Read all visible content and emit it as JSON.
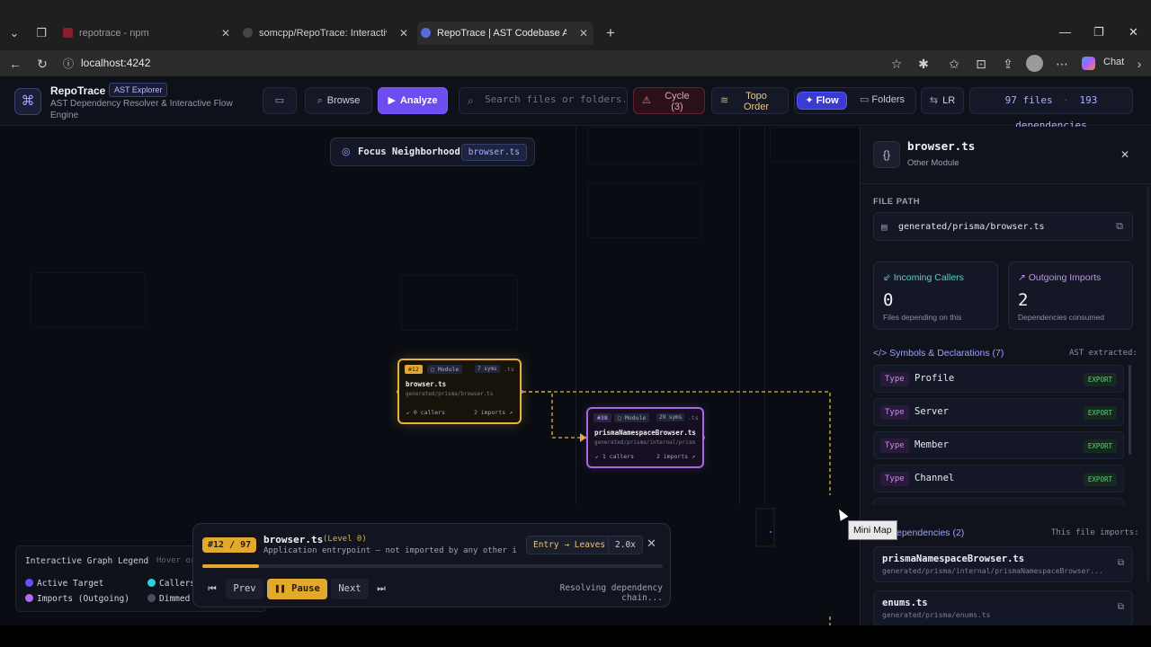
{
  "browser": {
    "tabs": [
      {
        "label": "repotrace - npm",
        "active": false
      },
      {
        "label": "somcpp/RepoTrace: Interactive co",
        "active": false
      },
      {
        "label": "RepoTrace | AST Codebase Archite",
        "active": true
      }
    ],
    "url": "localhost:4242",
    "chat_label": "Chat"
  },
  "header": {
    "brand": "RepoTrace",
    "brand_tag": "AST Explorer",
    "subtitle": "AST Dependency Resolver & Interactive Flow Engine",
    "browse_label": "Browse",
    "analyze_label": "Analyze",
    "search_placeholder": "Search files or folders...",
    "cycle_line1": "Cycle",
    "cycle_line2": "(3)",
    "topo_line1": "Topo",
    "topo_line2": "Order",
    "flow_label": "Flow",
    "folders_label": "Folders",
    "direction_label": "LR",
    "files_count": "97 files",
    "deps_count": "193 dependencies"
  },
  "canvas": {
    "focus_label": "Focus Neighborhood",
    "focus_file": "browser.ts",
    "node_a": {
      "badge": "#12",
      "kind": "Module",
      "syms": "7 syms",
      "ext": ".ts",
      "title": "browser.ts",
      "path": "generated/prisma/browser.ts",
      "callers": "0 callers",
      "imports": "2 imports"
    },
    "node_b": {
      "badge": "#38",
      "kind": "Module",
      "syms": "29 syms",
      "ext": ".ts",
      "title": "prismaNamespaceBrowser.ts",
      "path": "generated/prisma/internal/prismaNamespaceBrowser.ts",
      "callers": "1 callers",
      "imports": "2 imports"
    }
  },
  "playback": {
    "step": "#12 / 97",
    "title": "browser.ts",
    "level": "(Level 0)",
    "description": "Application entrypoint — not imported by any other inte...",
    "direction": "Entry → Leaves",
    "speed": "2.0x",
    "progress_fraction": 0.124,
    "prev_label": "Prev",
    "pause_label": "Pause",
    "next_label": "Next",
    "status": "Resolving dependency chain..."
  },
  "legend": {
    "title": "Interactive Graph Legend",
    "hint": "Hover or",
    "items": [
      {
        "label": "Active Target",
        "color": "#6d4cf0"
      },
      {
        "label": "Callers",
        "color": "#2fd0d8"
      },
      {
        "label": "Imports (Outgoing)",
        "color": "#b06af0"
      },
      {
        "label": "Dimmed",
        "color": "#4a4f60"
      }
    ]
  },
  "panel": {
    "file_name": "browser.ts",
    "file_type": "Other Module",
    "path_label": "FILE PATH",
    "path_value": "generated/prisma/browser.ts",
    "incoming_label": "Incoming Callers",
    "incoming_count": "0",
    "incoming_sub": "Files depending on this",
    "outgoing_label": "Outgoing Imports",
    "outgoing_count": "2",
    "outgoing_sub": "Dependencies consumed",
    "symbols_header": "Symbols & Declarations (7)",
    "ast_label": "AST extracted:",
    "symbols": [
      {
        "kind": "Type",
        "name": "Profile",
        "tag": "EXPORT"
      },
      {
        "kind": "Type",
        "name": "Server",
        "tag": "EXPORT"
      },
      {
        "kind": "Type",
        "name": "Member",
        "tag": "EXPORT"
      },
      {
        "kind": "Type",
        "name": "Channel",
        "tag": "EXPORT"
      }
    ],
    "deps_header": "ependencies (2)",
    "imports_label": "This file imports:",
    "deps": [
      {
        "name": "prismaNamespaceBrowser.ts",
        "path": "generated/prisma/internal/prismaNamespaceBrowser..."
      },
      {
        "name": "enums.ts",
        "path": "generated/prisma/enums.ts"
      }
    ]
  },
  "tooltip": "Mini Map",
  "colors": {
    "accent": "#6d4cf0",
    "target": "#e5b23a",
    "imports": "#a668e6",
    "callers": "#2fd0d8"
  },
  "icons": [
    "search-icon",
    "folder-icon",
    "warning-icon",
    "layers-icon",
    "close-icon",
    "copy-icon",
    "external-link-icon"
  ]
}
